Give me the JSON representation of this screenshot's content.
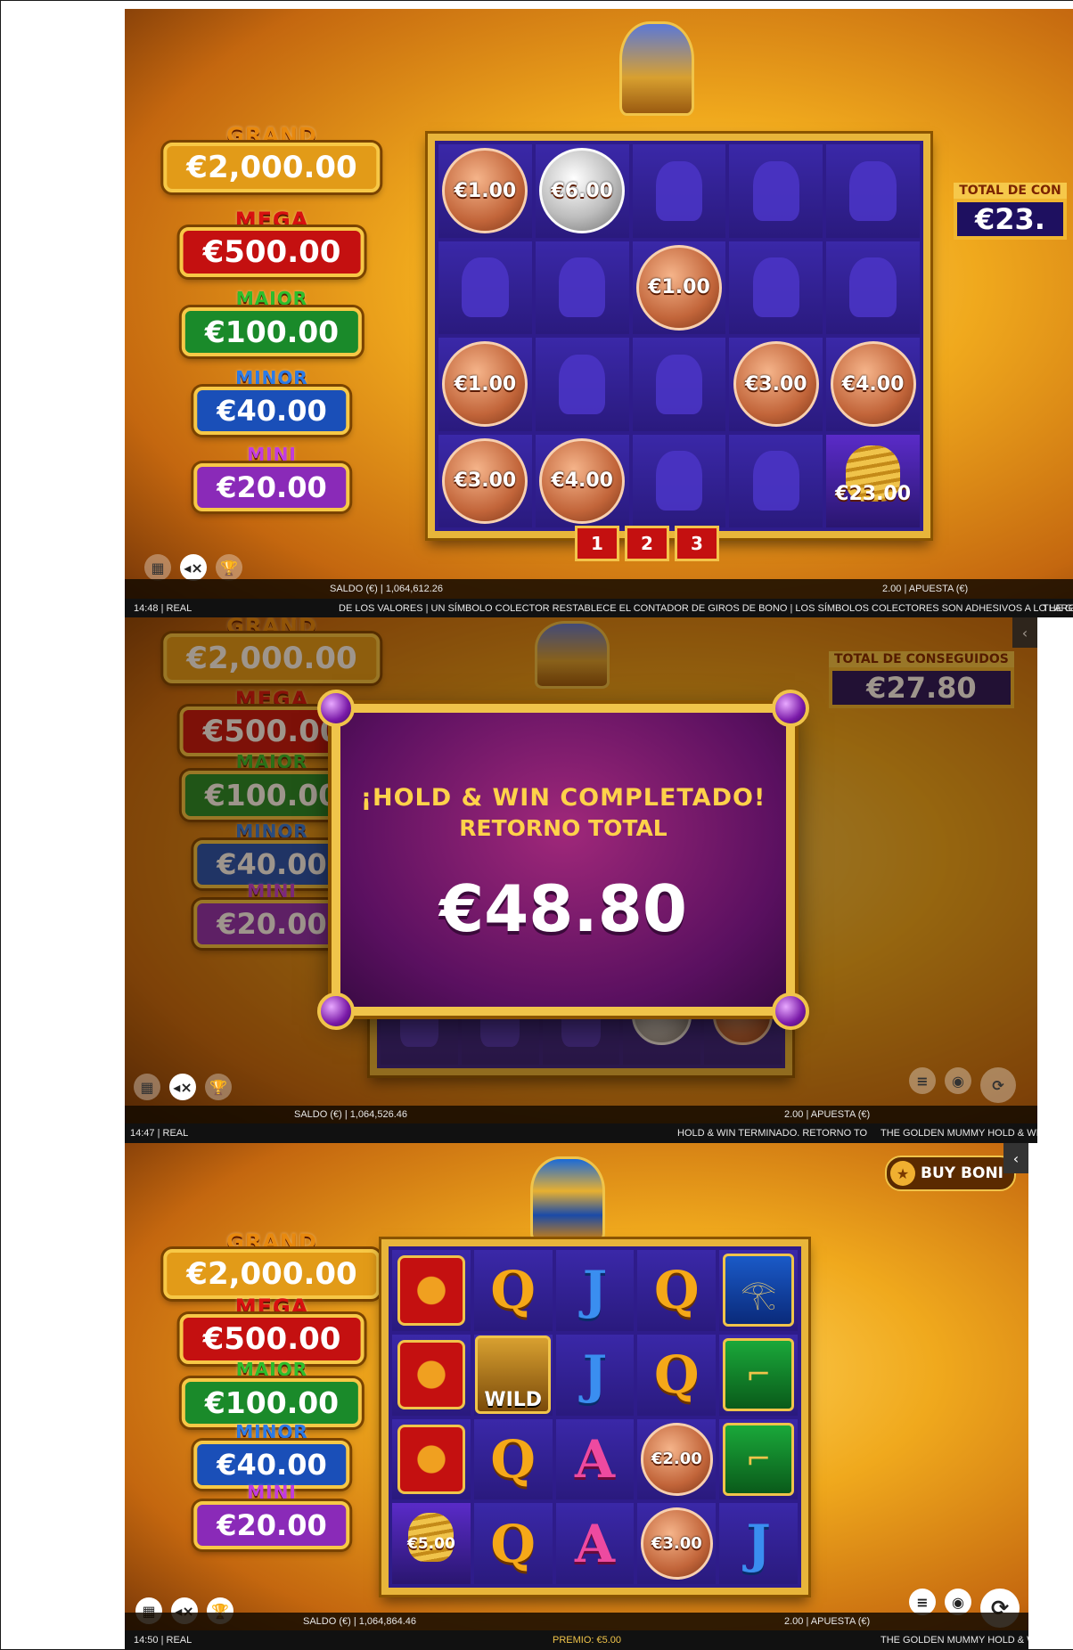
{
  "jackpots": {
    "grand": {
      "label": "GRAND",
      "amount": "€2,000.00"
    },
    "mega": {
      "label": "MEGA",
      "amount": "€500.00"
    },
    "major": {
      "label": "MAJOR",
      "amount": "€100.00"
    },
    "minor": {
      "label": "MINOR",
      "amount": "€40.00"
    },
    "mini": {
      "label": "MINI",
      "amount": "€20.00"
    }
  },
  "panel1": {
    "grid": [
      [
        "€1.00",
        "€6.00",
        "",
        "",
        ""
      ],
      [
        "",
        "",
        "€1.00",
        "",
        ""
      ],
      [
        "€1.00",
        "",
        "",
        "€3.00",
        "€4.00"
      ],
      [
        "€3.00",
        "€4.00",
        "",
        "",
        "€23.00"
      ]
    ],
    "silver_coin": "€6.00",
    "collector_cell": "€23.00",
    "pages": [
      "1",
      "2",
      "3"
    ],
    "total_label": "TOTAL DE CON",
    "total_value": "€23.",
    "balance": "SALDO (€) | 1,064,612.26",
    "bet": "2.00 | APUESTA (€)",
    "time": "14:48 | REAL",
    "ticker": "DE LOS VALORES | UN SÍMBOLO COLECTOR RESTABLECE EL CONTADOR DE GIROS DE BONO | LOS SÍMBOLOS COLECTORES SON ADHESIVOS A LO LARG",
    "ticker_end": "THE G"
  },
  "panel2": {
    "popup_line1": "¡HOLD & WIN COMPLETADO!",
    "popup_line2": "RETORNO TOTAL",
    "popup_amount": "€48.80",
    "total_label": "TOTAL DE CONSEGUIDOS",
    "total_value": "€27.80",
    "balance": "SALDO (€) | 1,064,526.46",
    "bet": "2.00 | APUESTA (€)",
    "time": "14:47 | REAL",
    "message": "HOLD & WIN TERMINADO. RETORNO TO",
    "game_name": "THE GOLDEN MUMMY HOLD & WIN"
  },
  "panel3": {
    "buy_bonus": "BUY BONI",
    "wild": "WILD",
    "coins": [
      "€2.00",
      "€3.00"
    ],
    "mummy_value": "€5.00",
    "balance": "SALDO (€) | 1,064,864.46",
    "bet": "2.00 | APUESTA (€)",
    "time": "14:50 | REAL",
    "prize": "PREMIO: €5.00",
    "game_name": "THE GOLDEN MUMMY HOLD & WIN"
  },
  "icons": {
    "menu": "▦",
    "sound": "◂×",
    "trophy": "🏆",
    "spin": "⟳",
    "autoplay": "◉",
    "turbo": "≡"
  },
  "colors": {
    "grand": "#e29b18",
    "mega": "#c41010",
    "major": "#1a8a2a",
    "minor": "#1a4fb8",
    "mini": "#8a2ab8"
  }
}
